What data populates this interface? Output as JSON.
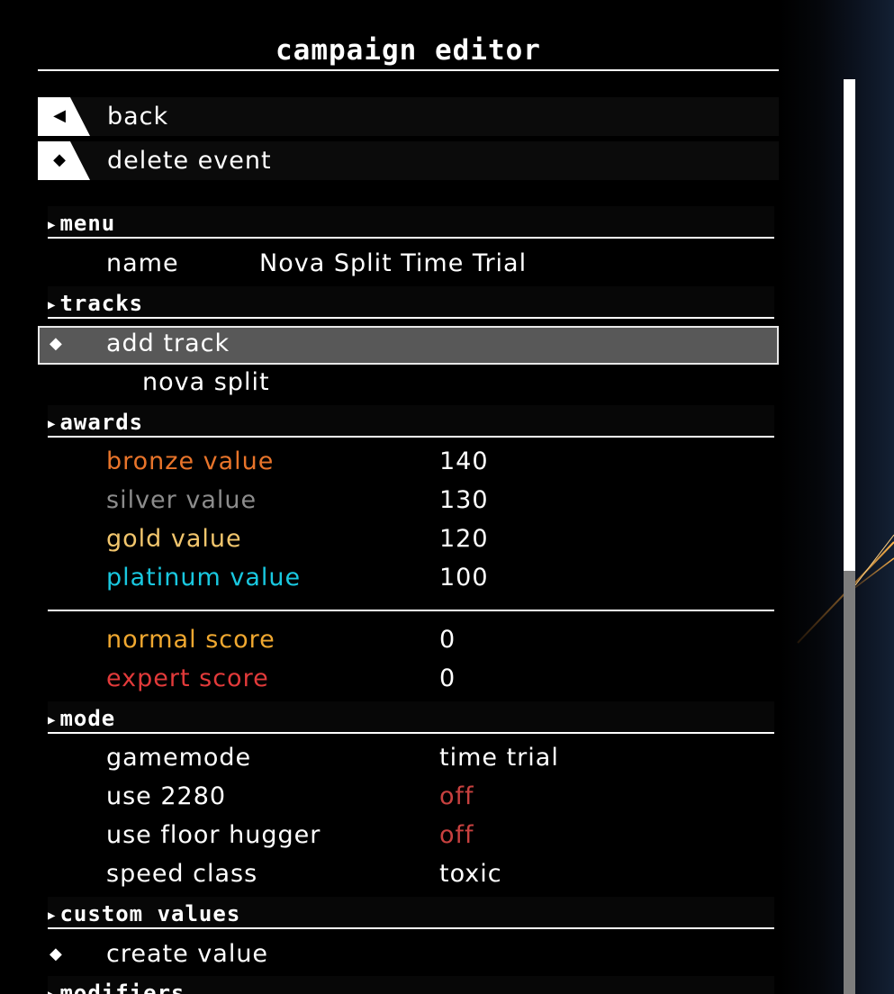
{
  "header": {
    "title": "campaign editor"
  },
  "buttons": {
    "back": "back",
    "delete": "delete event",
    "back_glyph": "◀",
    "delete_glyph": "◆"
  },
  "sections": {
    "menu": "menu",
    "tracks": "tracks",
    "awards": "awards",
    "mode": "mode",
    "custom_values": "custom values",
    "modifiers": "modifiers"
  },
  "menu": {
    "name_label": "name",
    "name_value": "Nova Split Time Trial"
  },
  "tracks": {
    "add_track": "add track",
    "items": [
      "nova split"
    ]
  },
  "awards": {
    "bronze_label": "bronze value",
    "bronze_value": "140",
    "silver_label": "silver value",
    "silver_value": "130",
    "gold_label": "gold value",
    "gold_value": "120",
    "platinum_label": "platinum value",
    "platinum_value": "100",
    "normal_label": "normal score",
    "normal_value": "0",
    "expert_label": "expert score",
    "expert_value": "0"
  },
  "mode": {
    "gamemode_label": "gamemode",
    "gamemode_value": "time trial",
    "use2280_label": "use 2280",
    "use2280_value": "off",
    "floor_label": "use floor hugger",
    "floor_value": "off",
    "speed_label": "speed class",
    "speed_value": "toxic"
  },
  "custom": {
    "create": "create value"
  },
  "glyphs": {
    "section_arrow": "▶",
    "diamond": "◆"
  },
  "colors": {
    "bronze": "#e8742a",
    "silver": "#8c8c8c",
    "gold": "#f2c66d",
    "platinum": "#19c8e0",
    "normal": "#f0a830",
    "expert": "#e23a3a",
    "off": "#c8413f"
  },
  "icons": {
    "scrollbar": "vertical-scrollbar"
  }
}
